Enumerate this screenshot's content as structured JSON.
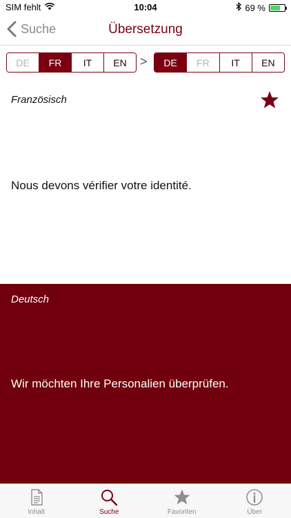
{
  "status_bar": {
    "carrier": "SIM fehlt",
    "time": "10:04",
    "battery_percent": "69 %",
    "battery_level": 0.69
  },
  "nav": {
    "back_label": "Suche",
    "title": "Übersetzung"
  },
  "source_languages": [
    {
      "label": "DE",
      "state": "disabled"
    },
    {
      "label": "FR",
      "state": "active"
    },
    {
      "label": "IT",
      "state": "normal"
    },
    {
      "label": "EN",
      "state": "normal"
    }
  ],
  "arrow": ">",
  "target_languages": [
    {
      "label": "DE",
      "state": "active"
    },
    {
      "label": "FR",
      "state": "disabled"
    },
    {
      "label": "IT",
      "state": "normal"
    },
    {
      "label": "EN",
      "state": "normal"
    }
  ],
  "source": {
    "language": "Französisch",
    "text": "Nous devons vérifier votre identité.",
    "favorite": true
  },
  "target": {
    "language": "Deutsch",
    "text": "Wir möchten Ihre Personalien überprüfen."
  },
  "tabs": [
    {
      "label": "Inhalt",
      "icon": "document-icon",
      "active": false
    },
    {
      "label": "Suche",
      "icon": "search-icon",
      "active": true
    },
    {
      "label": "Favoriten",
      "icon": "star-icon",
      "active": false
    },
    {
      "label": "Über",
      "icon": "info-icon",
      "active": false
    }
  ],
  "colors": {
    "accent": "#7a0010",
    "target_background": "#70000d",
    "inactive_gray": "#8e8e8e"
  }
}
